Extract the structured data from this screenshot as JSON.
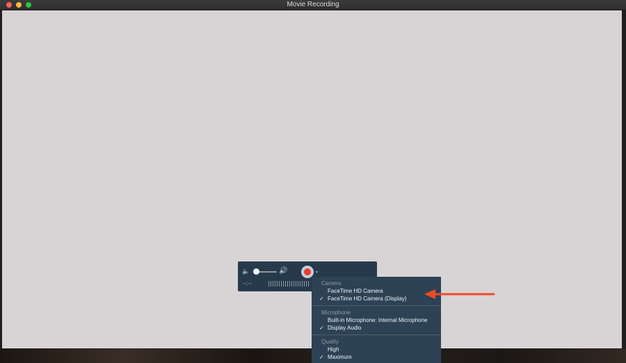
{
  "window": {
    "title": "Movie Recording"
  },
  "controls": {
    "elapsed_time": "--:--"
  },
  "menu": {
    "sections": [
      {
        "header": "Camera",
        "items": [
          {
            "label": "FaceTime HD Camera",
            "checked": false
          },
          {
            "label": "FaceTime HD Camera (Display)",
            "checked": true
          }
        ]
      },
      {
        "header": "Microphone",
        "items": [
          {
            "label": "Built-in Microphone: Internal Microphone",
            "checked": false
          },
          {
            "label": "Display Audio",
            "checked": true
          }
        ]
      },
      {
        "header": "Quality",
        "items": [
          {
            "label": "High",
            "checked": false
          },
          {
            "label": "Maximum",
            "checked": true
          }
        ]
      }
    ],
    "check_glyph": "✓"
  },
  "icons": {
    "volume_low": "🔈",
    "volume_high": "🔊",
    "chevron": "⌄"
  },
  "colors": {
    "record": "#f03a2e",
    "annotation_arrow": "#f04a25",
    "preview": "#d8d4d6",
    "menu_bg": "#2d4255"
  }
}
